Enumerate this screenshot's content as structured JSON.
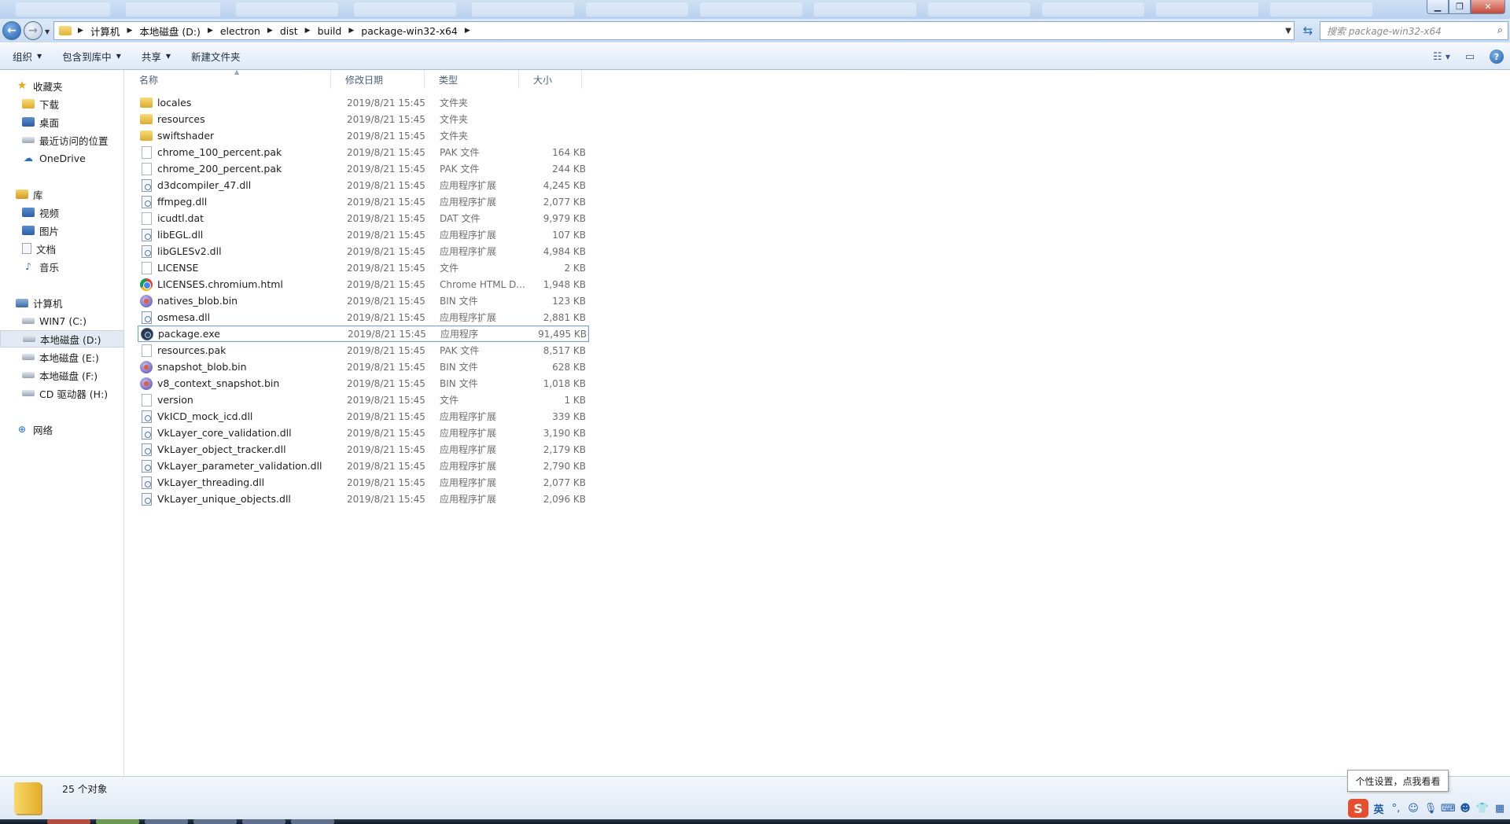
{
  "address": {
    "crumbs": [
      "计算机",
      "本地磁盘 (D:)",
      "electron",
      "dist",
      "build",
      "package-win32-x64"
    ],
    "search_placeholder": "搜索 package-win32-x64"
  },
  "toolbar": {
    "organize": "组织",
    "include_in_library": "包含到库中",
    "share": "共享",
    "new_folder": "新建文件夹"
  },
  "nav": {
    "favorites": "收藏夹",
    "downloads": "下载",
    "desktop": "桌面",
    "recent": "最近访问的位置",
    "onedrive": "OneDrive",
    "libraries": "库",
    "videos": "视频",
    "pictures": "图片",
    "documents": "文档",
    "music": "音乐",
    "computer": "计算机",
    "drive_c": "WIN7 (C:)",
    "drive_d": "本地磁盘 (D:)",
    "drive_e": "本地磁盘 (E:)",
    "drive_f": "本地磁盘 (F:)",
    "drive_h": "CD 驱动器 (H:)",
    "network": "网络"
  },
  "columns": {
    "name": "名称",
    "date": "修改日期",
    "type": "类型",
    "size": "大小"
  },
  "files": [
    {
      "name": "locales",
      "date": "2019/8/21 15:45",
      "type": "文件夹",
      "size": "",
      "icon": "folder"
    },
    {
      "name": "resources",
      "date": "2019/8/21 15:45",
      "type": "文件夹",
      "size": "",
      "icon": "folder"
    },
    {
      "name": "swiftshader",
      "date": "2019/8/21 15:45",
      "type": "文件夹",
      "size": "",
      "icon": "folder"
    },
    {
      "name": "chrome_100_percent.pak",
      "date": "2019/8/21 15:45",
      "type": "PAK 文件",
      "size": "164 KB",
      "icon": "file"
    },
    {
      "name": "chrome_200_percent.pak",
      "date": "2019/8/21 15:45",
      "type": "PAK 文件",
      "size": "244 KB",
      "icon": "file"
    },
    {
      "name": "d3dcompiler_47.dll",
      "date": "2019/8/21 15:45",
      "type": "应用程序扩展",
      "size": "4,245 KB",
      "icon": "dll"
    },
    {
      "name": "ffmpeg.dll",
      "date": "2019/8/21 15:45",
      "type": "应用程序扩展",
      "size": "2,077 KB",
      "icon": "dll"
    },
    {
      "name": "icudtl.dat",
      "date": "2019/8/21 15:45",
      "type": "DAT 文件",
      "size": "9,979 KB",
      "icon": "file"
    },
    {
      "name": "libEGL.dll",
      "date": "2019/8/21 15:45",
      "type": "应用程序扩展",
      "size": "107 KB",
      "icon": "dll"
    },
    {
      "name": "libGLESv2.dll",
      "date": "2019/8/21 15:45",
      "type": "应用程序扩展",
      "size": "4,984 KB",
      "icon": "dll"
    },
    {
      "name": "LICENSE",
      "date": "2019/8/21 15:45",
      "type": "文件",
      "size": "2 KB",
      "icon": "file"
    },
    {
      "name": "LICENSES.chromium.html",
      "date": "2019/8/21 15:45",
      "type": "Chrome HTML D...",
      "size": "1,948 KB",
      "icon": "chrome"
    },
    {
      "name": "natives_blob.bin",
      "date": "2019/8/21 15:45",
      "type": "BIN 文件",
      "size": "123 KB",
      "icon": "bin"
    },
    {
      "name": "osmesa.dll",
      "date": "2019/8/21 15:45",
      "type": "应用程序扩展",
      "size": "2,881 KB",
      "icon": "dll"
    },
    {
      "name": "package.exe",
      "date": "2019/8/21 15:45",
      "type": "应用程序",
      "size": "91,495 KB",
      "icon": "exe",
      "selected": true
    },
    {
      "name": "resources.pak",
      "date": "2019/8/21 15:45",
      "type": "PAK 文件",
      "size": "8,517 KB",
      "icon": "file"
    },
    {
      "name": "snapshot_blob.bin",
      "date": "2019/8/21 15:45",
      "type": "BIN 文件",
      "size": "628 KB",
      "icon": "bin"
    },
    {
      "name": "v8_context_snapshot.bin",
      "date": "2019/8/21 15:45",
      "type": "BIN 文件",
      "size": "1,018 KB",
      "icon": "bin"
    },
    {
      "name": "version",
      "date": "2019/8/21 15:45",
      "type": "文件",
      "size": "1 KB",
      "icon": "file"
    },
    {
      "name": "VkICD_mock_icd.dll",
      "date": "2019/8/21 15:45",
      "type": "应用程序扩展",
      "size": "339 KB",
      "icon": "dll"
    },
    {
      "name": "VkLayer_core_validation.dll",
      "date": "2019/8/21 15:45",
      "type": "应用程序扩展",
      "size": "3,190 KB",
      "icon": "dll"
    },
    {
      "name": "VkLayer_object_tracker.dll",
      "date": "2019/8/21 15:45",
      "type": "应用程序扩展",
      "size": "2,179 KB",
      "icon": "dll"
    },
    {
      "name": "VkLayer_parameter_validation.dll",
      "date": "2019/8/21 15:45",
      "type": "应用程序扩展",
      "size": "2,790 KB",
      "icon": "dll"
    },
    {
      "name": "VkLayer_threading.dll",
      "date": "2019/8/21 15:45",
      "type": "应用程序扩展",
      "size": "2,077 KB",
      "icon": "dll"
    },
    {
      "name": "VkLayer_unique_objects.dll",
      "date": "2019/8/21 15:45",
      "type": "应用程序扩展",
      "size": "2,096 KB",
      "icon": "dll"
    }
  ],
  "status": {
    "count": "25 个对象"
  },
  "tooltip": "个性设置，点我看看",
  "ime": {
    "logo": "S",
    "lang": "英"
  }
}
